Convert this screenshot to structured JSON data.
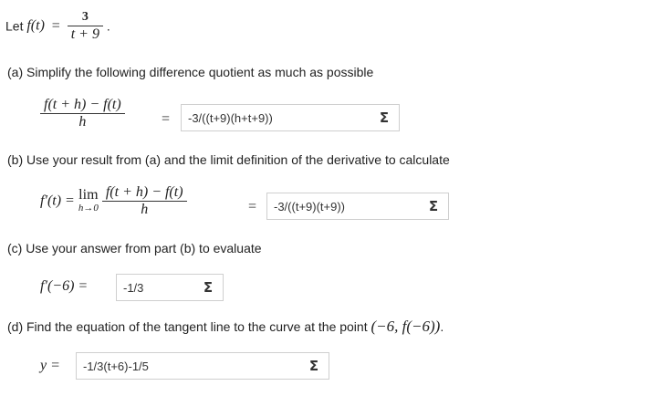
{
  "intro": {
    "let": "Let",
    "fn": "f(t)",
    "eq": "=",
    "numerator": "3",
    "denominator": "t + 9",
    "period": "."
  },
  "part_a": {
    "prompt": "(a)  Simplify the following difference quotient as much as possible",
    "numerator": "f(t + h) − f(t)",
    "denominator": "h",
    "eq": "=",
    "answer": "-3/((t+9)(h+t+9))",
    "sigma": "Σ"
  },
  "part_b": {
    "prompt": "(b)  Use your result from (a) and the limit definition of the derivative to calculate",
    "lhs": "f′(t) =",
    "lim": "lim",
    "lim_sub": "h→0",
    "numerator": "f(t + h) − f(t)",
    "denominator": "h",
    "eq": "=",
    "answer": "-3/((t+9)(t+9))",
    "sigma": "Σ"
  },
  "part_c": {
    "prompt": "(c)  Use your answer from part (b) to evaluate",
    "lhs": "f′(−6) =",
    "answer": "-1/3",
    "sigma": "Σ"
  },
  "part_d": {
    "prompt": "(d) Find the equation of the tangent line to the curve at the point",
    "point": "(−6, f(−6))",
    "period": ".",
    "lhs": "y =",
    "answer": "-1/3(t+6)-1/5",
    "sigma": "Σ"
  }
}
